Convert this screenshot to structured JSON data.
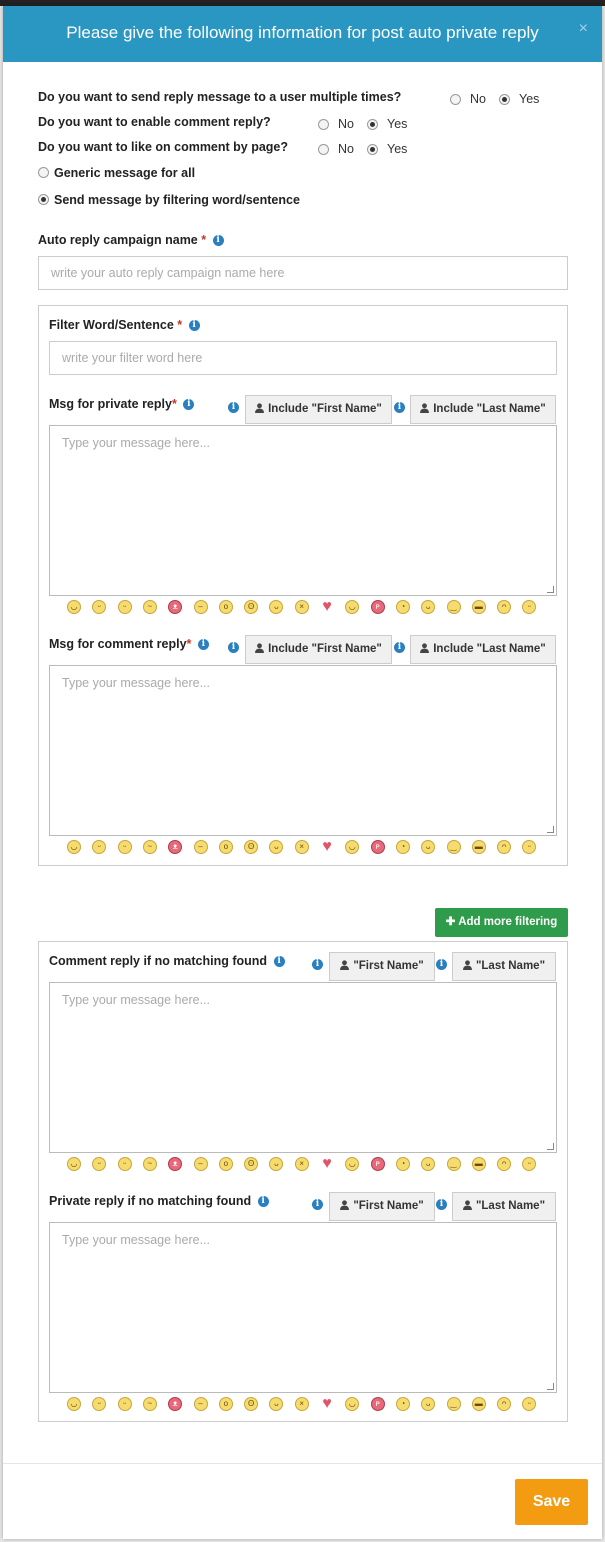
{
  "modal": {
    "title": "Please give the following information for post auto private reply",
    "close": "×"
  },
  "questions": [
    {
      "text": "Do you want to send reply message to a user multiple times?",
      "no": "No",
      "yes": "Yes",
      "selected": "Yes"
    },
    {
      "text": "Do you want to enable comment reply?",
      "no": "No",
      "yes": "Yes",
      "selected": "Yes"
    },
    {
      "text": "Do you want to like on comment by page?",
      "no": "No",
      "yes": "Yes",
      "selected": "Yes"
    }
  ],
  "mode": {
    "generic": "Generic message for all",
    "filtering": "Send message by filtering word/sentence",
    "selected": "filtering"
  },
  "campaign": {
    "label": "Auto reply campaign name",
    "required": "*",
    "placeholder": "write your auto reply campaign name here"
  },
  "filter": {
    "label": "Filter Word/Sentence",
    "required": "*",
    "placeholder": "write your filter word here",
    "private_label": "Msg for private reply",
    "comment_label": "Msg for comment reply",
    "include_first": "Include \"First Name\"",
    "include_last": "Include \"Last Name\"",
    "message_placeholder": "Type your message here..."
  },
  "add_more": "Add more filtering",
  "no_match": {
    "comment_label": "Comment reply if no matching found",
    "private_label": "Private reply if no matching found",
    "first": "\"First Name\"",
    "last": "\"Last Name\"",
    "message_placeholder": "Type your message here..."
  },
  "icons": {
    "info": "info-icon",
    "user": "user-icon",
    "plus": "plus-icon",
    "close": "close-icon"
  },
  "emoji_set": [
    "angel",
    "blush",
    "smile",
    "confused",
    "devil",
    "neutral",
    "surprised",
    "nerd",
    "grin",
    "tired",
    "heart",
    "happy",
    "tongue",
    "pacman",
    "smiley",
    "wink",
    "cool",
    "worried",
    "glad"
  ],
  "save": "Save",
  "colors": {
    "header": "#2a96c2",
    "add": "#2e9c4a",
    "save": "#f39c12",
    "info": "#2a7fc0"
  }
}
